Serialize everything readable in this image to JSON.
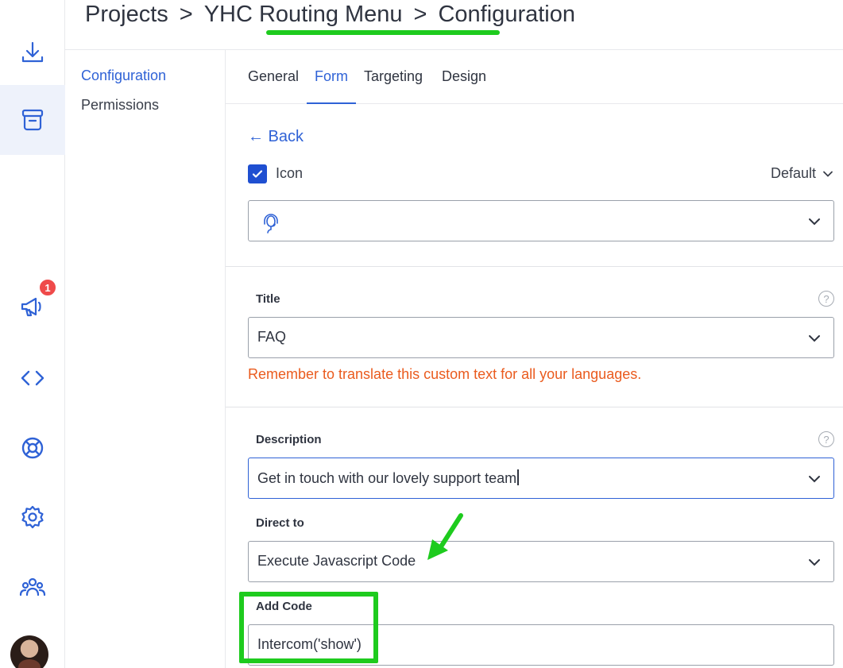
{
  "breadcrumb": {
    "items": [
      "Projects",
      "YHC Routing Menu",
      "Configuration"
    ],
    "separator": ">"
  },
  "rail": {
    "icons": [
      "download-icon",
      "archive-icon",
      "megaphone-icon",
      "code-icon",
      "lifebuoy-icon",
      "gear-icon",
      "team-icon"
    ],
    "notification_count": "1"
  },
  "subnav": {
    "items": [
      {
        "label": "Configuration",
        "active": true
      },
      {
        "label": "Permissions",
        "active": false
      }
    ]
  },
  "tabs": [
    {
      "label": "General",
      "active": false
    },
    {
      "label": "Form",
      "active": true
    },
    {
      "label": "Targeting",
      "active": false
    },
    {
      "label": "Design",
      "active": false
    }
  ],
  "form": {
    "back_label": "← Back",
    "icon_checkbox_label": "Icon",
    "icon_checked": true,
    "icon_style_select": "Default",
    "icon_select_value": "support-agent-icon",
    "title": {
      "label": "Title",
      "value": "FAQ",
      "help": "?"
    },
    "translation_warning": "Remember to translate this custom text for all your languages.",
    "description": {
      "label": "Description",
      "value": "Get in touch with our lovely support team",
      "help": "?"
    },
    "direct_to": {
      "label": "Direct to",
      "value": "Execute Javascript Code"
    },
    "add_code": {
      "label": "Add Code",
      "value": "Intercom('show')"
    }
  },
  "colors": {
    "accent": "#2f62d6",
    "checkbox": "#1f4fd1",
    "warning": "#ea5b1e",
    "annotation": "#1ecb1e",
    "badge": "#ef4a4a"
  }
}
